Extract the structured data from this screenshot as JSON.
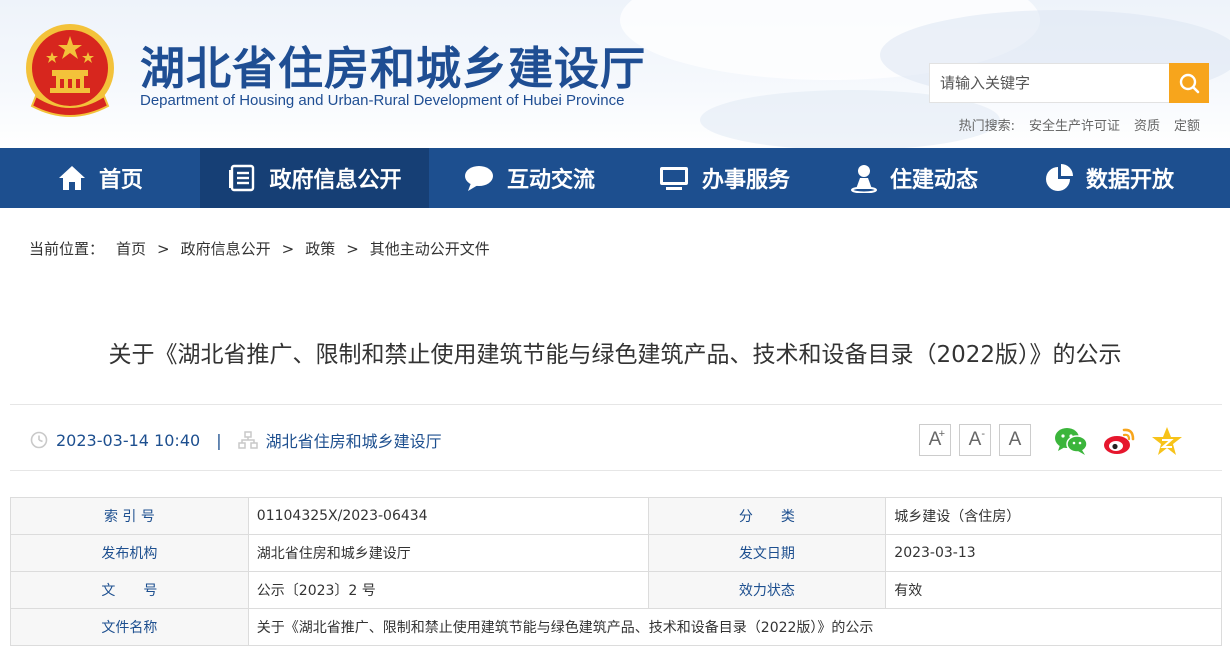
{
  "header": {
    "title": "湖北省住房和城乡建设厅",
    "subtitle": "Department of Housing and Urban-Rural Development of Hubei Province",
    "search_placeholder": "请输入关键字",
    "hot_label": "热门搜索:",
    "hot_items": [
      "安全生产许可证",
      "资质",
      "定额"
    ]
  },
  "nav": {
    "items": [
      {
        "label": "首页",
        "icon": "home-icon"
      },
      {
        "label": "政府信息公开",
        "icon": "document-list-icon",
        "active": true
      },
      {
        "label": "互动交流",
        "icon": "chat-bubble-icon"
      },
      {
        "label": "办事服务",
        "icon": "monitor-icon"
      },
      {
        "label": "住建动态",
        "icon": "person-pin-icon"
      },
      {
        "label": "数据开放",
        "icon": "pie-chart-icon"
      }
    ]
  },
  "breadcrumb": {
    "label": "当前位置：",
    "items": [
      "首页",
      "政府信息公开",
      "政策",
      "其他主动公开文件"
    ],
    "separator": ">"
  },
  "article": {
    "title": "关于《湖北省推广、限制和禁止使用建筑节能与绿色建筑产品、技术和设备目录（2022版）》的公示",
    "datetime": "2023-03-14 10:40",
    "source": "湖北省住房和城乡建设厅",
    "meta_separator": "|"
  },
  "font_buttons": [
    {
      "label": "A",
      "sup": "+"
    },
    {
      "label": "A",
      "sup": "-"
    },
    {
      "label": "A",
      "sup": ""
    }
  ],
  "share": [
    "wechat-icon",
    "weibo-icon",
    "qzone-icon"
  ],
  "info_table": {
    "rows": [
      {
        "l1": "索 引 号",
        "v1": "01104325X/2023-06434",
        "l2": "分　　类",
        "v2": "城乡建设（含住房）"
      },
      {
        "l1": "发布机构",
        "v1": "湖北省住房和城乡建设厅",
        "l2": "发文日期",
        "v2": "2023-03-13"
      },
      {
        "l1": "文　　号",
        "v1": "公示〔2023〕2 号",
        "l2": "效力状态",
        "v2": "有效"
      }
    ],
    "name_label": "文件名称",
    "name_value": "关于《湖北省推广、限制和禁止使用建筑节能与绿色建筑产品、技术和设备目录（2022版）》的公示"
  },
  "colors": {
    "brand_blue": "#1d4f8f",
    "nav_active": "#163f75",
    "search_orange": "#f7a51c",
    "emblem_red": "#d7261e",
    "emblem_gold": "#f3c23a"
  }
}
